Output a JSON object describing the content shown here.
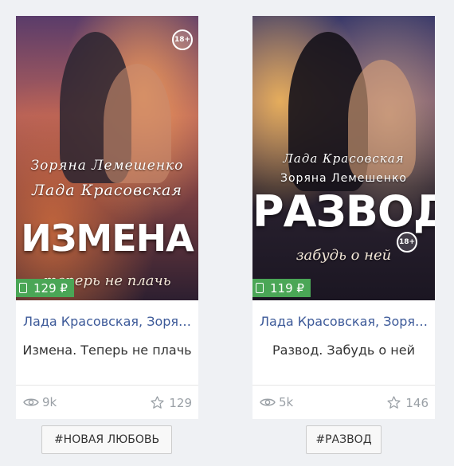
{
  "books": [
    {
      "cover": {
        "script_line1": "Зоряна Лемешенко",
        "script_line2": "Лада Красовская",
        "big_title": "ИЗМЕНА",
        "subtitle": "теперь не плачь",
        "age_badge": "18+"
      },
      "price": "129 ₽",
      "author": "Лада Красовская, Зоряна Лемешенко",
      "title": "Измена. Теперь не плачь",
      "views": "9k",
      "likes": "129",
      "tag": "#НОВАЯ ЛЮБОВЬ"
    },
    {
      "cover": {
        "script_line1": "Лада Красовская",
        "script_line2": "Зоряна Лемешенко",
        "big_title": "РАЗВОД",
        "subtitle": "забудь о ней",
        "age_badge": "18+"
      },
      "price": "119 ₽",
      "author": "Лада Красовская, Зоряна Лемешенко",
      "title": "Развод. Забудь о ней",
      "views": "5k",
      "likes": "146",
      "tag": "#РАЗВОД"
    }
  ],
  "colors": {
    "price_badge": "#4aa656",
    "author_link": "#3d5a99",
    "meta_gray": "#9aa0a6"
  },
  "icons": {
    "price": "book-icon",
    "views": "eye-icon",
    "likes": "star-icon"
  }
}
